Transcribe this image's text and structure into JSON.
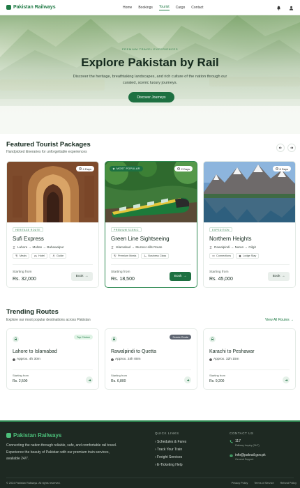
{
  "nav": {
    "brand": "Pakistan Railways",
    "links": [
      "Home",
      "Bookings",
      "Tourist",
      "Cargo",
      "Contact"
    ],
    "active": "Tourist"
  },
  "hero": {
    "eyebrow": "PREMIUM TRAVEL EXPERIENCES",
    "title": "Explore Pakistan by Rail",
    "subtitle": "Discover the heritage, breathtaking landscapes, and rich culture of the nation through our curated, scenic luxury journeys.",
    "cta": "Discover Journeys"
  },
  "packages": {
    "title": "Featured Tourist Packages",
    "subtitle": "Handpicked itineraries for unforgettable experiences",
    "cards": [
      {
        "tag": "HERITAGE ROUTE",
        "title": "Sufi Express",
        "route": "Lahore → Multan → Bahawalpur",
        "days": "4 Days",
        "features": [
          "Meals",
          "Hotel",
          "Guide"
        ],
        "price_label": "Starting from",
        "price": "Rs. 32,000",
        "book": "Book"
      },
      {
        "tag": "PREMIUM SCENIC",
        "badge": "MOST POPULAR",
        "title": "Green Line Sightseeing",
        "route": "Islamabad → Murree Hills Route",
        "days": "2 Days",
        "features": [
          "Premium Meals",
          "Business Class"
        ],
        "price_label": "Starting from",
        "price": "Rs. 18,500",
        "book": "Book"
      },
      {
        "tag": "EXPEDITION",
        "title": "Northern Heights",
        "route": "Rawalpindi → Naran → Gilgit",
        "days": "6 Days",
        "features": [
          "Connections",
          "Lodge Stay"
        ],
        "price_label": "Starting from",
        "price": "Rs. 45,000",
        "book": "Book"
      }
    ]
  },
  "routes": {
    "title": "Trending Routes",
    "subtitle": "Explore our most popular destinations across Pakistan",
    "view_all": "View All Routes →",
    "cards": [
      {
        "title": "Lahore to Islamabad",
        "time": "Approx. 4h 30m",
        "badge": "Top Choice",
        "price_label": "Starting from",
        "price": "Rs. 2,500"
      },
      {
        "title": "Rawalpindi to Quetta",
        "time": "Approx. 24h 00m",
        "badge": "Scenic Route",
        "price_label": "Starting from",
        "price": "Rs. 6,800"
      },
      {
        "title": "Karachi to Peshawar",
        "time": "Approx. 32h 15m",
        "badge": "",
        "price_label": "Starting from",
        "price": "Rs. 9,200"
      }
    ]
  },
  "footer": {
    "brand": "Pakistan Railways",
    "description": "Connecting the nation through reliable, safe, and comfortable rail travel. Experience the beauty of Pakistan with our premium train services, available 24/7.",
    "quick_links_title": "QUICK LINKS",
    "quick_links": [
      "› Schedules & Fares",
      "› Track Your Train",
      "› Freight Services",
      "› E-Ticketing Help"
    ],
    "contact_title": "CONTACT US",
    "phone": "117",
    "phone_sub": "Railway Inquiry (24/7)",
    "email": "info@pakrail.gov.pk",
    "email_sub": "General Support",
    "copyright": "© 2024 Pakistan Railways. All rights reserved.",
    "legal": [
      "Privacy Policy",
      "Terms of Service",
      "Refund Policy"
    ]
  },
  "colors": {
    "brand": "#1f7a45",
    "brand_dark": "#1d7041",
    "footer_bg": "#1e2922",
    "accent_light": "#4cbf7a"
  }
}
